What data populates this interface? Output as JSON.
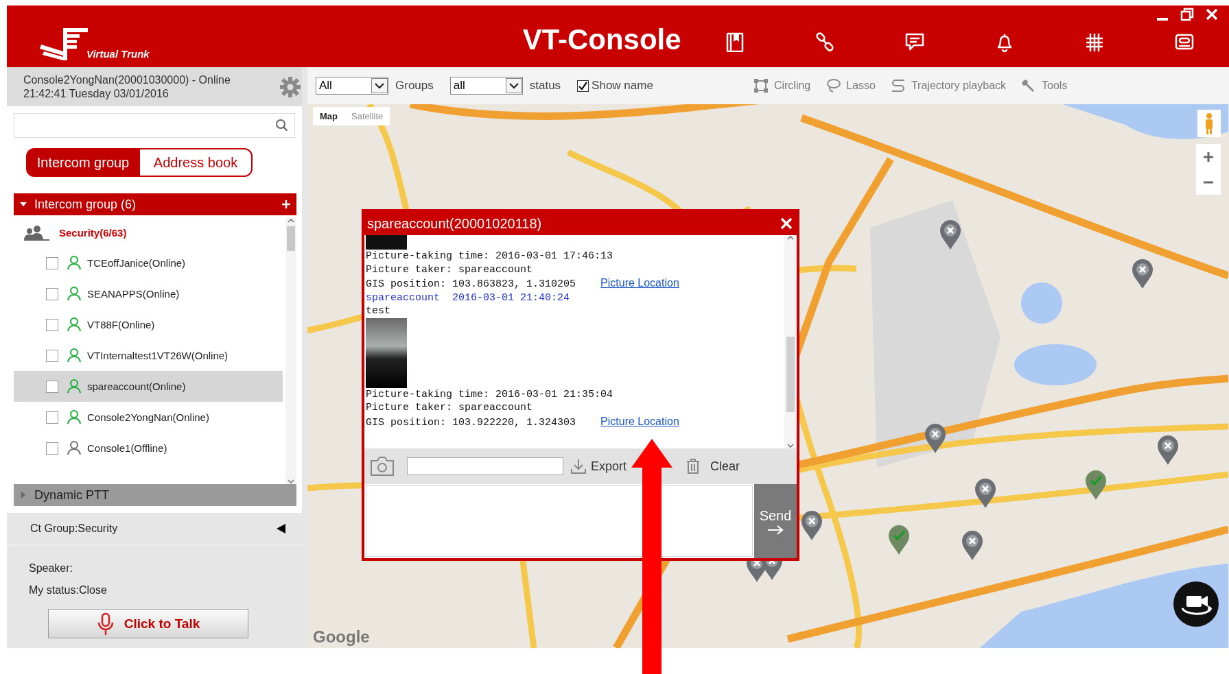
{
  "window": {
    "logo_text": "Virtual Trunk",
    "title": "VT-Console"
  },
  "user_status": {
    "account": "Console2YongNan(20001030000) - Online",
    "datetime": "21:42:41 Tuesday 03/01/2016"
  },
  "tabs": [
    {
      "label": "Intercom group",
      "selected": true
    },
    {
      "label": "Address book",
      "selected": false
    }
  ],
  "groups": [
    {
      "label": "Intercom group (6)",
      "expanded": true,
      "children": [
        {
          "label": "Security(6/63)",
          "children": [
            {
              "label": "TCEoffJanice(Online)",
              "online": true,
              "checked": false,
              "selected": false
            },
            {
              "label": "SEANAPPS(Online)",
              "online": true,
              "checked": false,
              "selected": false
            },
            {
              "label": "VT88F(Online)",
              "online": true,
              "checked": false,
              "selected": false
            },
            {
              "label": "VTInternaltest1VT26W(Online)",
              "online": true,
              "checked": false,
              "selected": false
            },
            {
              "label": "spareaccount(Online)",
              "online": true,
              "checked": false,
              "selected": true
            },
            {
              "label": "Console2YongNan(Online)",
              "online": true,
              "checked": false,
              "selected": false
            },
            {
              "label": "Console1(Offline)",
              "online": false,
              "checked": false,
              "selected": false
            }
          ]
        }
      ]
    },
    {
      "label": "Dynamic PTT",
      "expanded": false
    }
  ],
  "ptt": {
    "current_group": "Ct Group:Security",
    "speaker": "Speaker:",
    "my_status": "My status:Close",
    "talk_button": "Click to Talk"
  },
  "toolbar": {
    "group_filter": "All",
    "groups_label": "Groups",
    "status_filter": "all",
    "status_label": "status",
    "show_name": {
      "label": "Show name",
      "checked": true
    },
    "tools": [
      {
        "kind": "circling",
        "label": "Circling"
      },
      {
        "kind": "lasso",
        "label": "Lasso"
      },
      {
        "kind": "trajectory",
        "label": "Trajectory playback"
      },
      {
        "kind": "tools",
        "label": "Tools"
      }
    ]
  },
  "map": {
    "types": [
      {
        "label": "Map",
        "selected": true
      },
      {
        "label": "Satellite",
        "selected": false
      }
    ],
    "logo": "Google",
    "markers": [
      {
        "online": false
      },
      {
        "online": false
      },
      {
        "online": false
      },
      {
        "online": false
      },
      {
        "online": true
      },
      {
        "online": false
      },
      {
        "online": false
      },
      {
        "online": true
      },
      {
        "online": false
      },
      {
        "online": false
      },
      {
        "online": false
      }
    ]
  },
  "chat": {
    "title": "spareaccount(20001020118)",
    "messages": [
      {
        "kind": "picture",
        "time": "Picture-taking time: 2016-03-01 17:46:13",
        "taker": "Picture taker: spareaccount",
        "gis": "GIS position: 103.863823, 1.310205",
        "link": "Picture Location"
      },
      {
        "kind": "text",
        "sender": "spareaccount",
        "time": "2016-03-01 21:40:24",
        "body": "test"
      },
      {
        "kind": "picture",
        "time": "Picture-taking time: 2016-03-01 21:35:04",
        "taker": "Picture taker: spareaccount",
        "gis": "GIS position: 103.922220, 1.324303",
        "link": "Picture Location"
      }
    ],
    "export_label": "Export",
    "clear_label": "Clear",
    "send_label": "Send"
  }
}
